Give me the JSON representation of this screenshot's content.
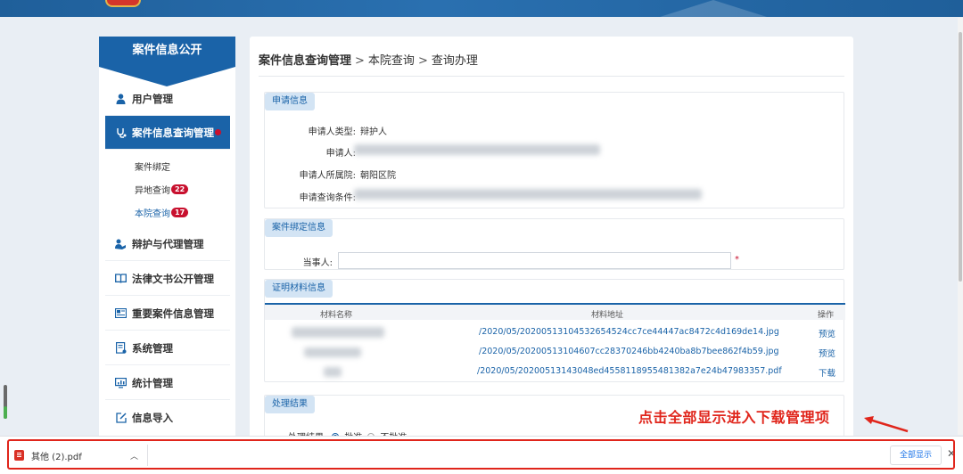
{
  "sidebar": {
    "title": "案件信息公开",
    "items": [
      {
        "label": "用户管理",
        "icon": "user-icon"
      },
      {
        "label": "案件信息查询管理",
        "icon": "stethoscope-icon"
      },
      {
        "label": "辩护与代理管理",
        "icon": "handshake-icon"
      },
      {
        "label": "法律文书公开管理",
        "icon": "book-icon"
      },
      {
        "label": "重要案件信息管理",
        "icon": "news-icon"
      },
      {
        "label": "系统管理",
        "icon": "settings-doc-icon"
      },
      {
        "label": "统计管理",
        "icon": "monitor-chart-icon"
      },
      {
        "label": "信息导入",
        "icon": "edit-import-icon"
      }
    ],
    "subitems": [
      {
        "label": "案件绑定"
      },
      {
        "label": "异地查询",
        "badge": "22"
      },
      {
        "label": "本院查询",
        "badge": "17"
      }
    ]
  },
  "breadcrumb": {
    "root": "案件信息查询管理",
    "sep": ">",
    "level2": "本院查询",
    "level3": "查询办理"
  },
  "applicant": {
    "title": "申请信息",
    "type_label": "申请人类型:",
    "type_value": "辩护人",
    "name_label": "申请人:",
    "court_label": "申请人所属院:",
    "court_value": "朝阳区院",
    "condition_label": "申请查询条件:"
  },
  "binding": {
    "title": "案件绑定信息",
    "party_label": "当事人:",
    "required_mark": "*"
  },
  "materials": {
    "title": "证明材料信息",
    "columns": [
      "材料名称",
      "材料地址",
      "操作"
    ],
    "rows": [
      {
        "address": "/2020/05/20200513104532654524cc7ce44447ac8472c4d169de14.jpg",
        "action": "预览"
      },
      {
        "address": "/2020/05/20200513104607cc28370246bb4240ba8b7bee862f4b59.jpg",
        "action": "预览"
      },
      {
        "address": "/2020/05/20200513143048ed4558118955481382a7e24b47983357.pdf",
        "action": "下载"
      }
    ]
  },
  "result": {
    "title": "处理结果",
    "label": "处理结果:",
    "option_approve": "批准",
    "option_reject": "不批准"
  },
  "annotation": "点击全部显示进入下载管理项",
  "download_bar": {
    "file_name": "其他 (2).pdf",
    "show_all": "全部显示",
    "close": "✕"
  },
  "colors": {
    "primary": "#1a63a8",
    "badge": "#c8102e",
    "annotation": "#e0251b"
  }
}
